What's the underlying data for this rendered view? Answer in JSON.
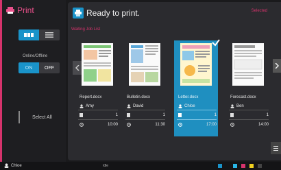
{
  "app": {
    "title": "Print"
  },
  "header": {
    "status": "Ready to print.",
    "selected_label": "Selected"
  },
  "sidebar": {
    "online_label": "Online/Offline",
    "on_label": "ON",
    "off_label": "OFF",
    "select_all_label": "Select All"
  },
  "list": {
    "title": "Waiting Job List"
  },
  "jobs": [
    {
      "file": "Report.docx",
      "user": "Amy",
      "copies": "1",
      "time": "10:00"
    },
    {
      "file": "Bulletin.docx",
      "user": "David",
      "copies": "1",
      "time": "11:30"
    },
    {
      "file": "Letter.docx",
      "user": "Chloe",
      "copies": "1",
      "time": "17:00"
    },
    {
      "file": "Forecast.docx",
      "user": "Ben",
      "copies": "1",
      "time": "14:00"
    }
  ],
  "statusbar": {
    "user": "Chloe",
    "info": "Idle"
  },
  "colors": {
    "accent": "#d6336c",
    "selection": "#1f8fc0",
    "toggle_on": "#1a93c9"
  }
}
